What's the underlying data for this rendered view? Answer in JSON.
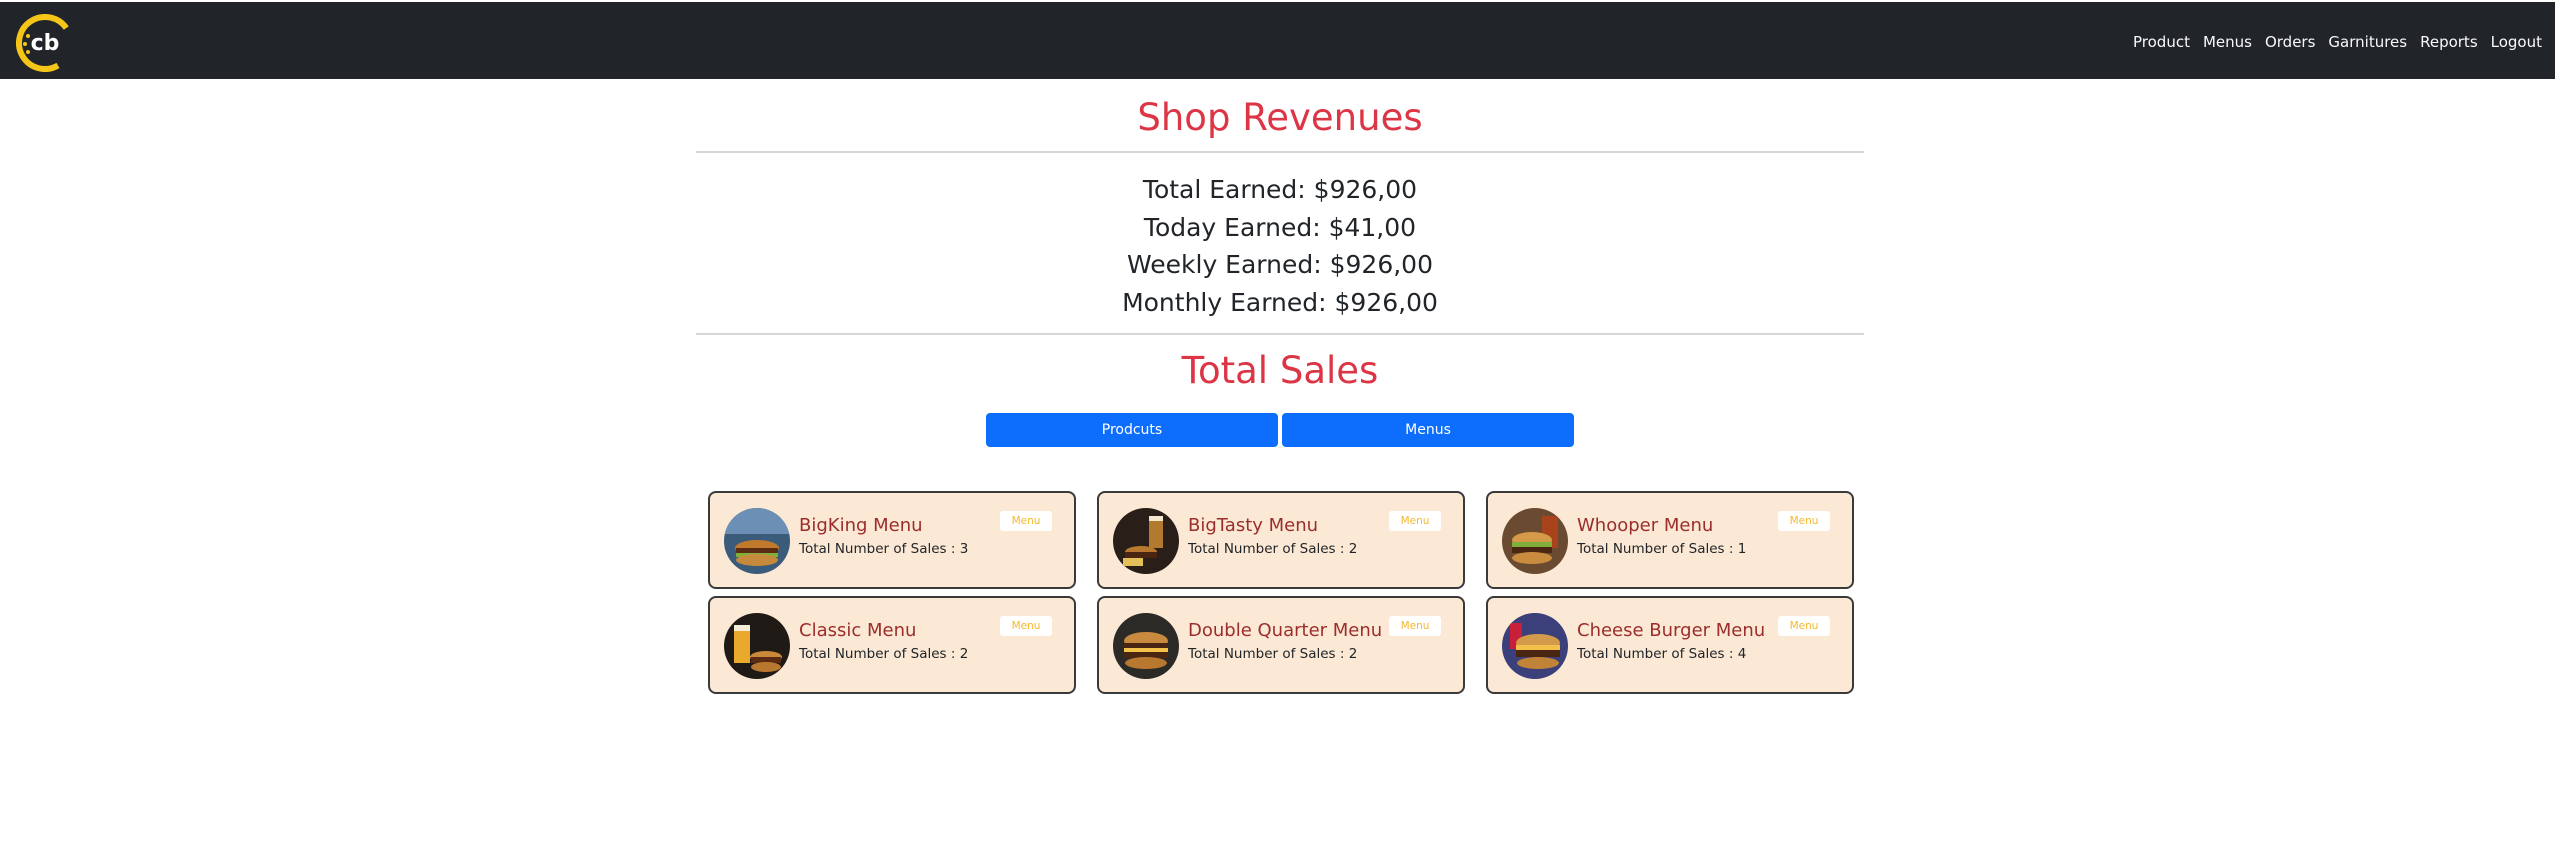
{
  "nav": {
    "links": [
      "Product",
      "Menus",
      "Orders",
      "Garnitures",
      "Reports",
      "Logout"
    ]
  },
  "revenues": {
    "title": "Shop Revenues",
    "total": "Total Earned: $926,00",
    "today": "Today Earned: $41,00",
    "weekly": "Weekly Earned: $926,00",
    "monthly": "Monthly Earned: $926,00"
  },
  "sales": {
    "title": "Total Sales",
    "tabs": [
      "Prodcuts",
      "Menus"
    ],
    "cards": [
      {
        "name": "BigKing Menu",
        "sales": "Total Number of Sales : 3",
        "badge": "Menu"
      },
      {
        "name": "BigTasty Menu",
        "sales": "Total Number of Sales : 2",
        "badge": "Menu"
      },
      {
        "name": "Whooper Menu",
        "sales": "Total Number of Sales : 1",
        "badge": "Menu"
      },
      {
        "name": "Classic Menu",
        "sales": "Total Number of Sales : 2",
        "badge": "Menu"
      },
      {
        "name": "Double Quarter Menu",
        "sales": "Total Number of Sales : 2",
        "badge": "Menu"
      },
      {
        "name": "Cheese Burger Menu",
        "sales": "Total Number of Sales : 4",
        "badge": "Menu"
      }
    ]
  },
  "colors": {
    "navbar": "#212529",
    "accent": "#dc3545",
    "button": "#0d6efd",
    "card_bg": "#fbe9d5",
    "card_title": "#9b2d2d",
    "badge_text": "#f5b82e"
  }
}
